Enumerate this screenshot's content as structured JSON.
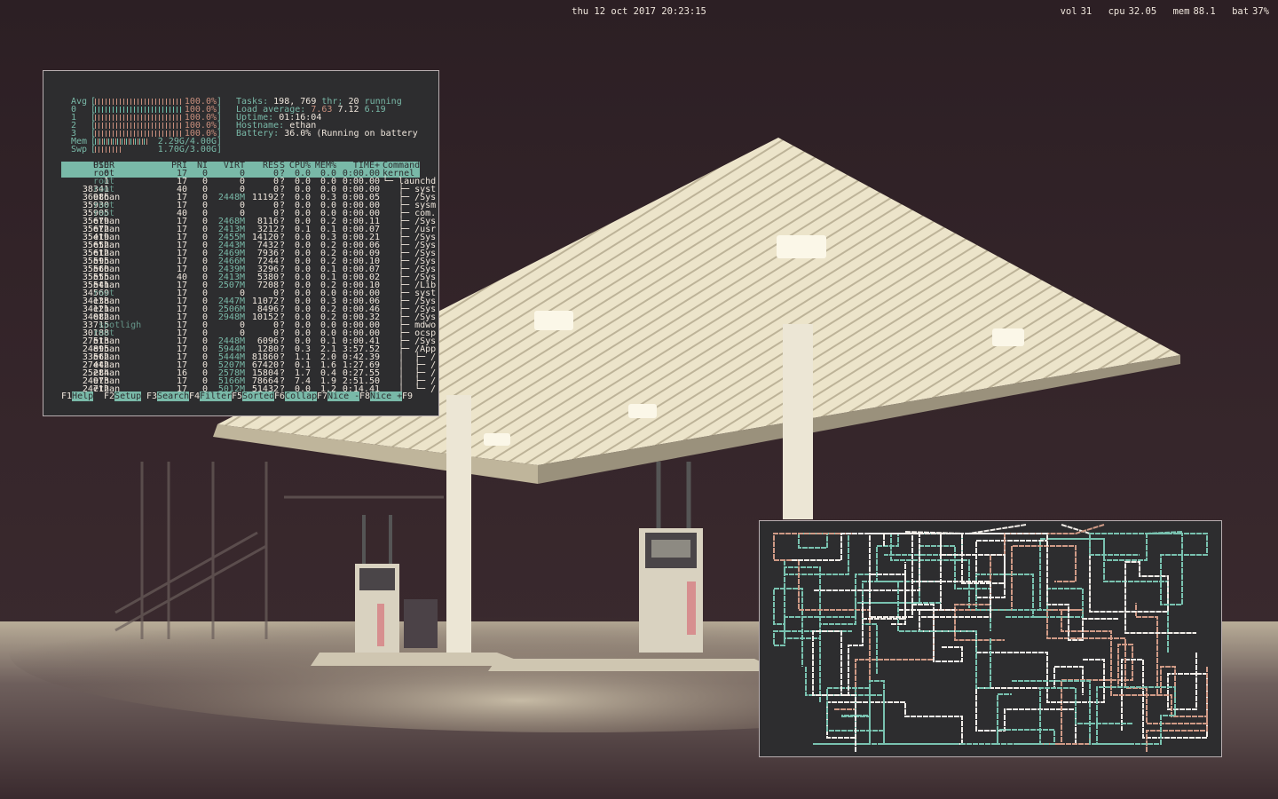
{
  "topbar": {
    "clock": "thu 12 oct 2017 20:23:15",
    "status": [
      {
        "label": "vol",
        "value": "31"
      },
      {
        "label": "cpu",
        "value": "32.05"
      },
      {
        "label": "mem",
        "value": "88.1"
      },
      {
        "label": "bat",
        "value": "37%"
      }
    ]
  },
  "htop": {
    "meters": [
      {
        "label": "Avg",
        "value": "100.0%",
        "fill": 1.0
      },
      {
        "label": "0",
        "value": "100.0%",
        "fill": 1.0
      },
      {
        "label": "1",
        "value": "100.0%",
        "fill": 1.0
      },
      {
        "label": "2",
        "value": "100.0%",
        "fill": 1.0
      },
      {
        "label": "3",
        "value": "100.0%",
        "fill": 1.0
      },
      {
        "label": "Mem",
        "value": "2.29G/4.00G",
        "fill": 0.57
      },
      {
        "label": "Swp",
        "value": "1.70G/3.00G",
        "fill": 0.57
      }
    ],
    "summary": {
      "tasks_label": "Tasks:",
      "tasks": "198,",
      "thr": "769",
      "thr_label": "thr;",
      "running": "20",
      "running_label": "running",
      "load_label": "Load average:",
      "load1": "7.63",
      "load5": "7.12",
      "load15": "6.19",
      "uptime_label": "Uptime:",
      "uptime": "01:16:04",
      "hostname_label": "Hostname:",
      "hostname": "ethan",
      "battery_label": "Battery:",
      "battery": "36.0% (Running on battery"
    },
    "columns": [
      "PID",
      "USER",
      "PRI",
      "NI",
      "VIRT",
      "RES",
      "S",
      "CPU%",
      "MEM%",
      "TIME+",
      "Command"
    ],
    "processes": [
      [
        "0",
        "root",
        "17",
        "0",
        "0",
        "0",
        "?",
        "0.0",
        "0.0",
        "0:00.00",
        "kernel_tas"
      ],
      [
        "1",
        "root",
        "17",
        "0",
        "0",
        "0",
        "?",
        "0.0",
        "0.0",
        "0:00.00",
        "└─ launchd"
      ],
      [
        "38341",
        "root",
        "40",
        "0",
        "0",
        "0",
        "?",
        "0.0",
        "0.0",
        "0:00.00",
        "   ├─ syst"
      ],
      [
        "36986",
        "ethan",
        "17",
        "0",
        "2448M",
        "11192",
        "?",
        "0.0",
        "0.3",
        "0:00.05",
        "   ├─ /Sys"
      ],
      [
        "35930",
        "root",
        "17",
        "0",
        "0",
        "0",
        "?",
        "0.0",
        "0.0",
        "0:00.00",
        "   ├─ sysm"
      ],
      [
        "35905",
        "root",
        "40",
        "0",
        "0",
        "0",
        "?",
        "0.0",
        "0.0",
        "0:00.00",
        "   ├─ com."
      ],
      [
        "35679",
        "ethan",
        "17",
        "0",
        "2468M",
        "8116",
        "?",
        "0.0",
        "0.2",
        "0:00.11",
        "   ├─ /Sys"
      ],
      [
        "35672",
        "ethan",
        "17",
        "0",
        "2413M",
        "3212",
        "?",
        "0.1",
        "0.1",
        "0:00.07",
        "   ├─ /usr"
      ],
      [
        "35419",
        "ethan",
        "17",
        "0",
        "2455M",
        "14120",
        "?",
        "0.0",
        "0.3",
        "0:00.21",
        "   ├─ /Sys"
      ],
      [
        "35652",
        "ethan",
        "17",
        "0",
        "2443M",
        "7432",
        "?",
        "0.0",
        "0.2",
        "0:00.06",
        "   ├─ /Sys"
      ],
      [
        "35612",
        "ethan",
        "17",
        "0",
        "2469M",
        "7936",
        "?",
        "0.0",
        "0.2",
        "0:00.09",
        "   ├─ /Sys"
      ],
      [
        "35595",
        "ethan",
        "17",
        "0",
        "2466M",
        "7244",
        "?",
        "0.0",
        "0.2",
        "0:00.10",
        "   ├─ /Sys"
      ],
      [
        "35560",
        "ethan",
        "17",
        "0",
        "2439M",
        "3296",
        "?",
        "0.0",
        "0.1",
        "0:00.07",
        "   ├─ /Sys"
      ],
      [
        "35555",
        "ethan",
        "40",
        "0",
        "2413M",
        "5380",
        "?",
        "0.0",
        "0.1",
        "0:00.02",
        "   ├─ /Sys"
      ],
      [
        "35541",
        "ethan",
        "17",
        "0",
        "2507M",
        "7208",
        "?",
        "0.0",
        "0.2",
        "0:00.10",
        "   ├─ /Lib"
      ],
      [
        "34569",
        "root",
        "17",
        "0",
        "0",
        "0",
        "?",
        "0.0",
        "0.0",
        "0:00.00",
        "   ├─ syst"
      ],
      [
        "34138",
        "ethan",
        "17",
        "0",
        "2447M",
        "11072",
        "?",
        "0.0",
        "0.3",
        "0:00.06",
        "   ├─ /Sys"
      ],
      [
        "34121",
        "ethan",
        "17",
        "0",
        "2506M",
        "8496",
        "?",
        "0.0",
        "0.2",
        "0:00.46",
        "   ├─ /Sys"
      ],
      [
        "34082",
        "ethan",
        "17",
        "0",
        "2948M",
        "10152",
        "?",
        "0.0",
        "0.2",
        "0:00.32",
        "   ├─ /Sys"
      ],
      [
        "33715",
        "_spotligh",
        "17",
        "0",
        "0",
        "0",
        "?",
        "0.0",
        "0.0",
        "0:00.00",
        "   ├─ mdwo"
      ],
      [
        "30188",
        "root",
        "17",
        "0",
        "0",
        "0",
        "?",
        "0.0",
        "0.0",
        "0:00.00",
        "   ├─ ocsp"
      ],
      [
        "27513",
        "ethan",
        "17",
        "0",
        "2448M",
        "6096",
        "?",
        "0.0",
        "0.1",
        "0:00.41",
        "   ├─ /Sys"
      ],
      [
        "24895",
        "ethan",
        "17",
        "0",
        "5944M",
        "1280",
        "?",
        "0.3",
        "2.1",
        "3:57.52",
        "   ├─ /App"
      ],
      [
        "33562",
        "ethan",
        "17",
        "0",
        "5444M",
        "81860",
        "?",
        "1.1",
        "2.0",
        "0:42.39",
        "   │  ├─ /"
      ],
      [
        "27442",
        "ethan",
        "17",
        "0",
        "5207M",
        "67420",
        "?",
        "0.1",
        "1.6",
        "1:27.69",
        "   │  ├─ /"
      ],
      [
        "25284",
        "ethan",
        "16",
        "0",
        "2578M",
        "15804",
        "?",
        "1.7",
        "0.4",
        "0:27.55",
        "   │  ├─ /"
      ],
      [
        "24973",
        "ethan",
        "17",
        "0",
        "5166M",
        "78664",
        "?",
        "7.4",
        "1.9",
        "2:51.50",
        "   │  ├─ /"
      ],
      [
        "24712",
        "ethan",
        "17",
        "0",
        "5012M",
        "51432",
        "?",
        "0.0",
        "1.2",
        "0:14.41",
        "   │  └─ /"
      ]
    ],
    "fkeys": [
      {
        "key": "F1",
        "label": "Help"
      },
      {
        "key": "F2",
        "label": "Setup"
      },
      {
        "key": "F3",
        "label": "Search"
      },
      {
        "key": "F4",
        "label": "Filter"
      },
      {
        "key": "F5",
        "label": "Sorted"
      },
      {
        "key": "F6",
        "label": "Collap"
      },
      {
        "key": "F7",
        "label": "Nice -"
      },
      {
        "key": "F8",
        "label": "Nice +"
      },
      {
        "key": "F9",
        "label": ""
      }
    ]
  },
  "pipes": {
    "colors": {
      "white": "#f2eee9",
      "teal": "#79c2b0",
      "salmon": "#cf9a86",
      "bg": "#2d2d2f"
    }
  },
  "colors": {
    "accent": "#79b9a8",
    "text": "#efe6dc",
    "warm": "#c98f7d"
  }
}
